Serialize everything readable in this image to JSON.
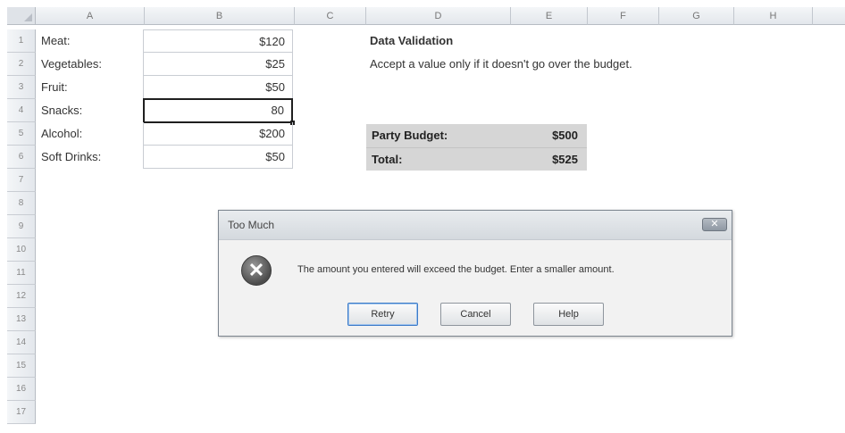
{
  "columns": [
    "A",
    "B",
    "C",
    "D",
    "E",
    "F",
    "G",
    "H"
  ],
  "rows": [
    "1",
    "2",
    "3",
    "4",
    "5",
    "6",
    "7",
    "8",
    "9",
    "10",
    "11",
    "12",
    "13",
    "14",
    "15",
    "16",
    "17"
  ],
  "items": [
    {
      "label": "Meat:",
      "value": "$120"
    },
    {
      "label": "Vegetables:",
      "value": "$25"
    },
    {
      "label": "Fruit:",
      "value": "$50"
    },
    {
      "label": "Snacks:",
      "value": "80"
    },
    {
      "label": "Alcohol:",
      "value": "$200"
    },
    {
      "label": "Soft Drinks:",
      "value": "$50"
    }
  ],
  "notes": {
    "title": "Data Validation",
    "description": "Accept a value only if it doesn't go over the budget."
  },
  "budget": {
    "party_label": "Party Budget:",
    "party_value": "$500",
    "total_label": "Total:",
    "total_value": "$525"
  },
  "dialog": {
    "title": "Too Much",
    "close": "✕",
    "message": "The amount you entered will exceed the budget. Enter a smaller amount.",
    "buttons": [
      "Retry",
      "Cancel",
      "Help"
    ]
  }
}
